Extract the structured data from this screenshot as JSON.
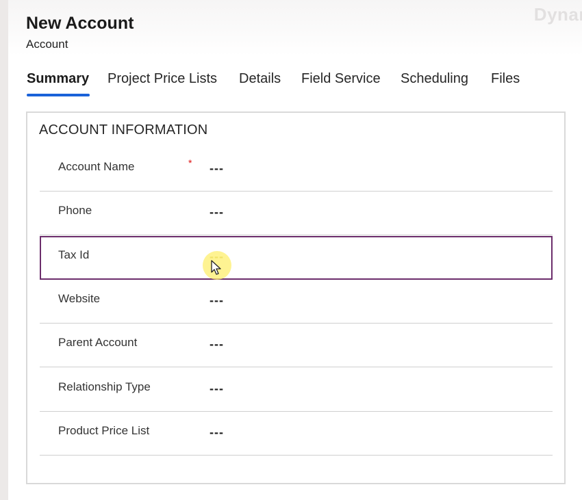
{
  "header": {
    "title": "New Account",
    "subtitle": "Account",
    "brand": "Dynar"
  },
  "tabs": [
    {
      "label": "Summary",
      "active": true
    },
    {
      "label": "Project Price Lists",
      "active": false
    },
    {
      "label": "Details",
      "active": false
    },
    {
      "label": "Field Service",
      "active": false
    },
    {
      "label": "Scheduling",
      "active": false
    },
    {
      "label": "Files",
      "active": false
    }
  ],
  "section": {
    "title": "ACCOUNT INFORMATION",
    "fields": [
      {
        "label": "Account Name",
        "value": "---",
        "required": "*"
      },
      {
        "label": "Phone",
        "value": "---"
      },
      {
        "label": "Tax Id",
        "value": "---",
        "focused": true
      },
      {
        "label": "Website",
        "value": "---"
      },
      {
        "label": "Parent Account",
        "value": "---"
      },
      {
        "label": "Relationship Type",
        "value": "---"
      },
      {
        "label": "Product Price List",
        "value": "---"
      }
    ]
  },
  "colors": {
    "accent": "#1a62d9",
    "focus_border": "#6b2d6b",
    "required": "#dd1111",
    "cursor_highlight": "#fdef6e"
  }
}
